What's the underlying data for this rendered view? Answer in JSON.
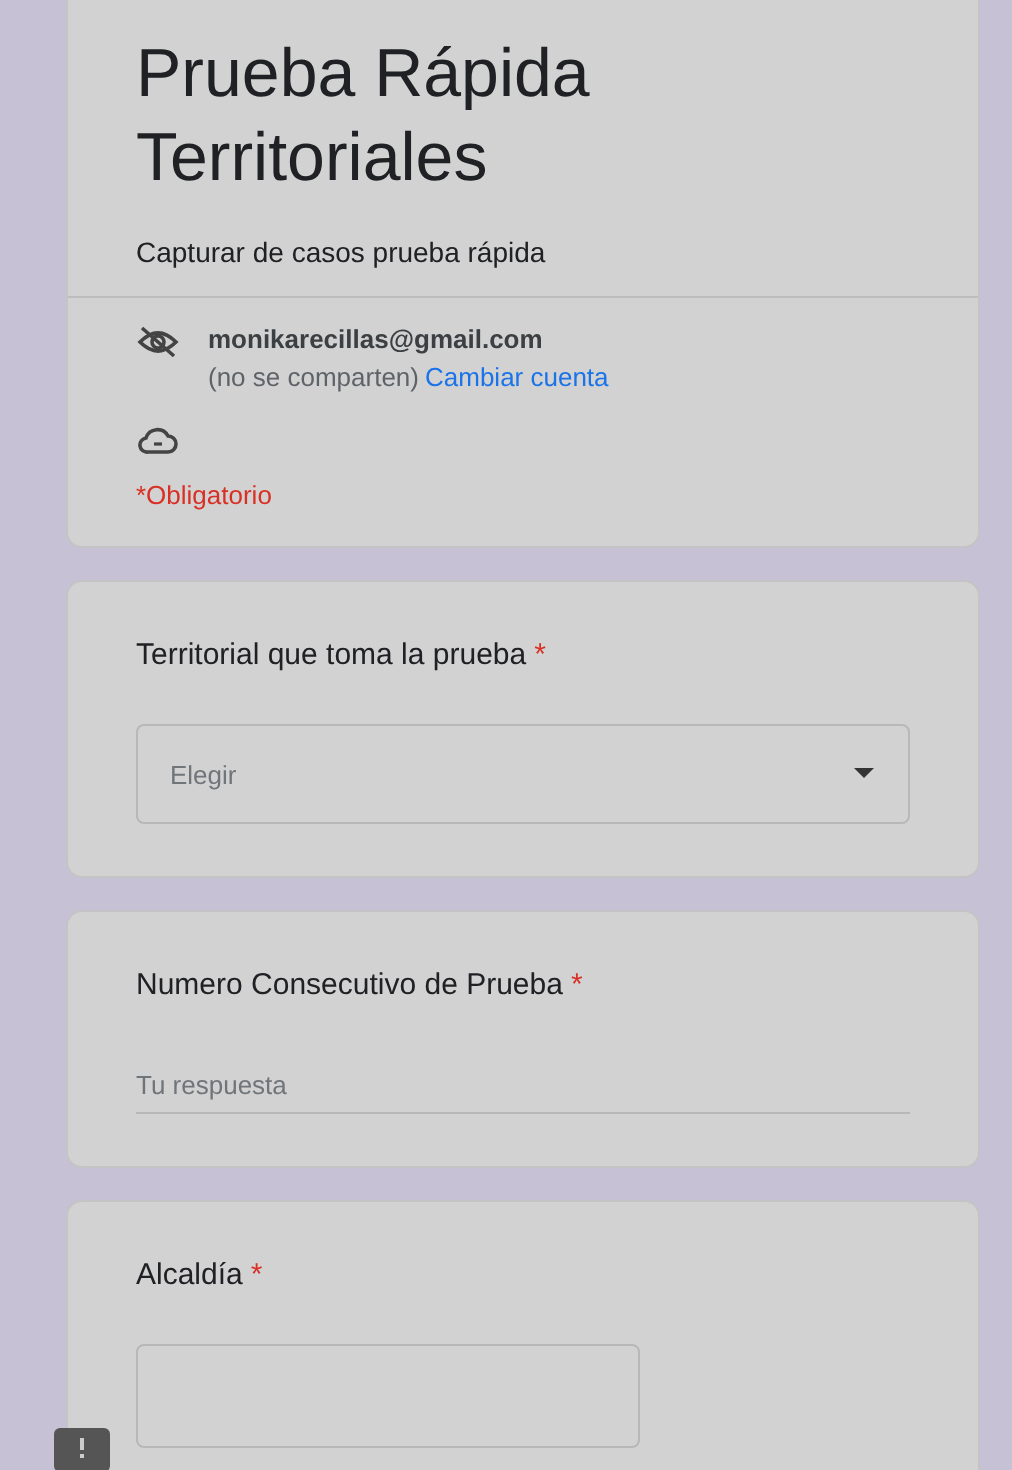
{
  "form": {
    "title_lines": [
      "Prueba Rápida",
      "Territoriales"
    ],
    "description": "Capturar de casos prueba rápida",
    "account": {
      "email": "monikarecillas@gmail.com",
      "note": "(no se comparten)",
      "switch_link": "Cambiar cuenta"
    },
    "required_note": "*Obligatorio"
  },
  "questions": [
    {
      "kind": "dropdown",
      "label": "Territorial que toma la prueba",
      "required_mark": "*",
      "value": "Elegir"
    },
    {
      "kind": "text",
      "label": "Numero Consecutivo de Prueba",
      "required_mark": "*",
      "placeholder": "Tu respuesta"
    },
    {
      "kind": "box",
      "label": "Alcaldía",
      "required_mark": "*"
    }
  ]
}
